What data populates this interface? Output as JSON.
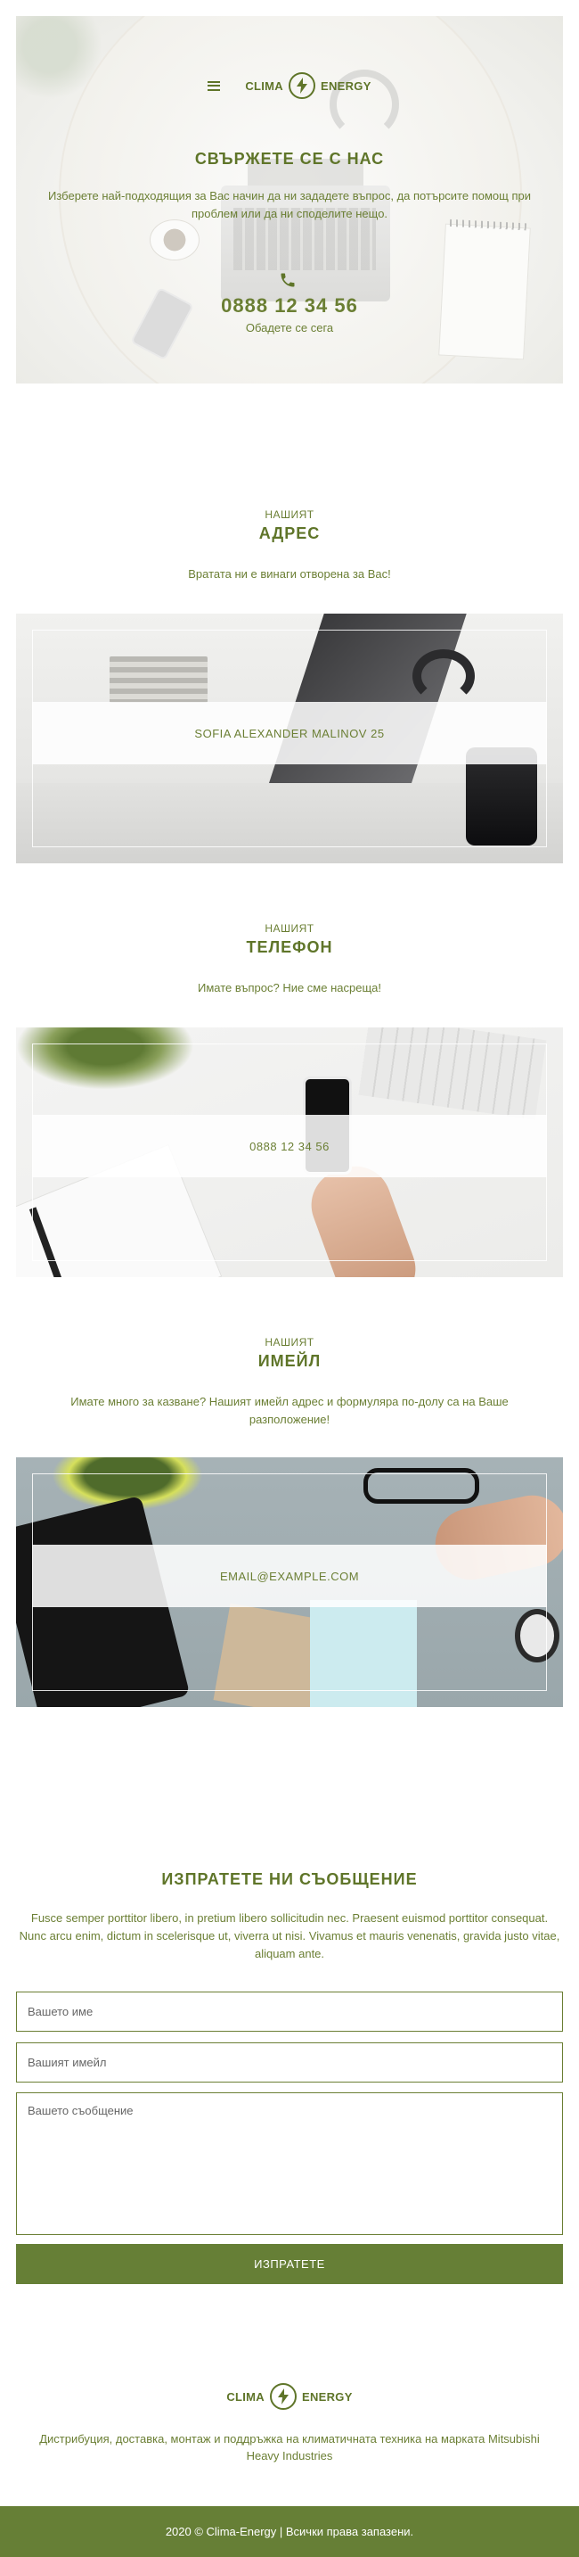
{
  "brand": {
    "part1": "CLIMA",
    "part2": "ENERGY"
  },
  "hero": {
    "title": "СВЪРЖЕТЕ СЕ С НАС",
    "text": "Изберете най-подходящия за Вас начин да ни зададете въпрос, да потърсите помощ при проблем или да ни споделите нещо.",
    "phone": "0888 12 34 56",
    "call": "Обадете се сега"
  },
  "address": {
    "sub": "НАШИЯТ",
    "title": "АДРЕС",
    "desc": "Вратата ни е винаги отворена за Вас!",
    "value": "SOFIA ALEXANDER MALINOV 25"
  },
  "phone": {
    "sub": "НАШИЯТ",
    "title": "ТЕЛЕФОН",
    "desc": "Имате въпрос? Ние сме насреща!",
    "value": "0888 12 34 56"
  },
  "email": {
    "sub": "НАШИЯТ",
    "title": "ИМЕЙЛ",
    "desc": "Имате много за казване? Нашият имейл адрес и формуляра по-долу са на Ваше разположение!",
    "value": "EMAIL@EXAMPLE.COM"
  },
  "form": {
    "title": "ИЗПРАТЕТЕ НИ СЪОБЩЕНИЕ",
    "desc": "Fusce semper porttitor libero, in pretium libero sollicitudin nec. Praesent euismod porttitor consequat. Nunc arcu enim, dictum in scelerisque ut, viverra ut nisi. Vivamus et mauris venenatis, gravida justo vitae, aliquam ante.",
    "name_placeholder": "Вашето име",
    "email_placeholder": "Вашият имейл",
    "message_placeholder": "Вашето съобщение",
    "submit": "ИЗПРАТЕТЕ"
  },
  "footer": {
    "desc": "Дистрибуция, доставка, монтаж и поддръжка на климатичната техника на марката Mitsubishi Heavy Industries",
    "copyright": "2020 © Clima-Energy | Всички права запазени."
  },
  "colors": {
    "accent": "#667f36",
    "text": "#6b7f34"
  },
  "icons": [
    "menu-icon",
    "bolt-icon",
    "phone-icon"
  ]
}
